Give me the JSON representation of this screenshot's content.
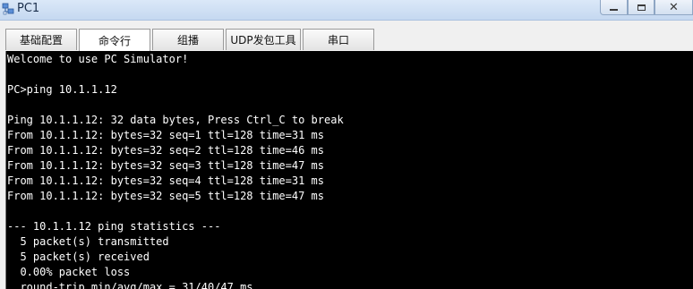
{
  "window": {
    "title": "PC1",
    "icon": "pc-network-icon"
  },
  "tabs": [
    {
      "label": "基础配置",
      "active": false
    },
    {
      "label": "命令行",
      "active": true
    },
    {
      "label": "组播",
      "active": false
    },
    {
      "label": "UDP发包工具",
      "active": false
    },
    {
      "label": "串口",
      "active": false
    }
  ],
  "terminal": {
    "lines": [
      "Welcome to use PC Simulator!",
      "",
      "PC>ping 10.1.1.12",
      "",
      "Ping 10.1.1.12: 32 data bytes, Press Ctrl_C to break",
      "From 10.1.1.12: bytes=32 seq=1 ttl=128 time=31 ms",
      "From 10.1.1.12: bytes=32 seq=2 ttl=128 time=46 ms",
      "From 10.1.1.12: bytes=32 seq=3 ttl=128 time=47 ms",
      "From 10.1.1.12: bytes=32 seq=4 ttl=128 time=31 ms",
      "From 10.1.1.12: bytes=32 seq=5 ttl=128 time=47 ms",
      "",
      "--- 10.1.1.12 ping statistics ---",
      "  5 packet(s) transmitted",
      "  5 packet(s) received",
      "  0.00% packet loss",
      "  round-trip min/avg/max = 31/40/47 ms"
    ]
  },
  "colors": {
    "terminal_bg": "#000000",
    "terminal_fg": "#ffffff",
    "titlebar": "#c5d8f0"
  }
}
